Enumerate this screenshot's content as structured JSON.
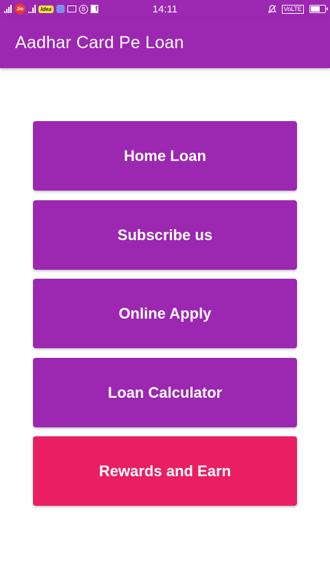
{
  "status_bar": {
    "carrier_badge": "Jio",
    "carrier2_badge": "Idea",
    "time": "14:11",
    "volte": "VoLTE",
    "icons": [
      "signal-icon",
      "jio-icon",
      "idea-icon",
      "app-icon",
      "mail-icon",
      "b-icon",
      "facebook-icon",
      "bell-off-icon",
      "battery-icon"
    ]
  },
  "app_bar": {
    "title": "Aadhar Card Pe Loan"
  },
  "menu": {
    "home_loan": "Home Loan",
    "subscribe": "Subscribe us",
    "online_apply": "Online Apply",
    "loan_calculator": "Loan Calculator",
    "rewards": "Rewards and Earn"
  },
  "colors": {
    "primary": "#9c27b0",
    "accent": "#e91e63",
    "background": "#ffffff"
  }
}
